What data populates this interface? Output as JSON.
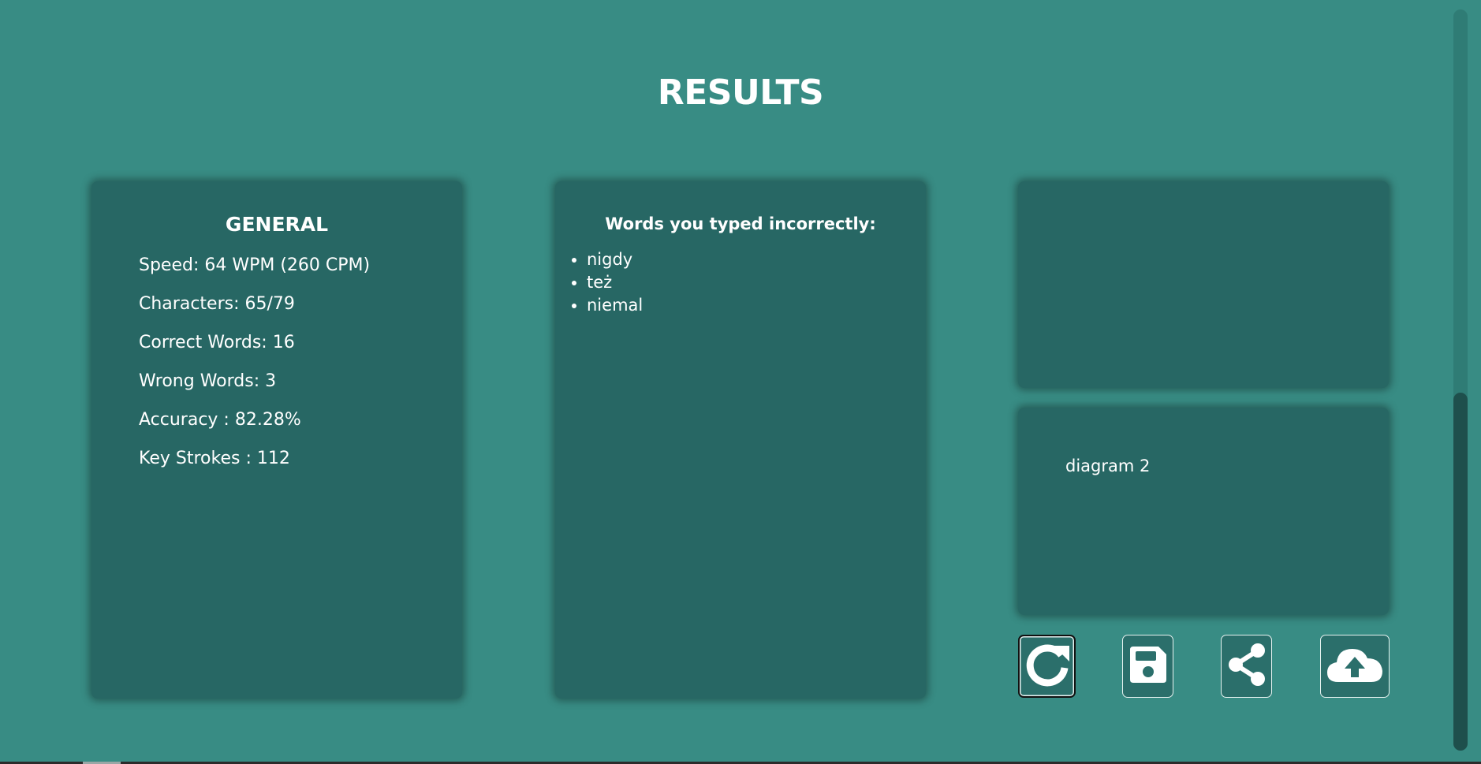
{
  "page": {
    "title": "RESULTS"
  },
  "general": {
    "title": "GENERAL",
    "stats": [
      "Speed: 64 WPM (260 CPM)",
      "Characters: 65/79",
      "Correct Words: 16",
      "Wrong Words: 3",
      "Accuracy : 82.28%",
      "Key Strokes : 112"
    ]
  },
  "incorrect_words": {
    "title": "Words you typed incorrectly:",
    "items": [
      "nigdy",
      "też",
      "niemal"
    ]
  },
  "diagrams": {
    "diagram2_label": "diagram 2"
  },
  "actions": [
    {
      "icon": "restart-icon"
    },
    {
      "icon": "save-icon"
    },
    {
      "icon": "share-icon"
    },
    {
      "icon": "cloud-upload-icon"
    }
  ],
  "colors": {
    "background": "#388c84",
    "card": "#276764",
    "text": "#ffffff"
  }
}
